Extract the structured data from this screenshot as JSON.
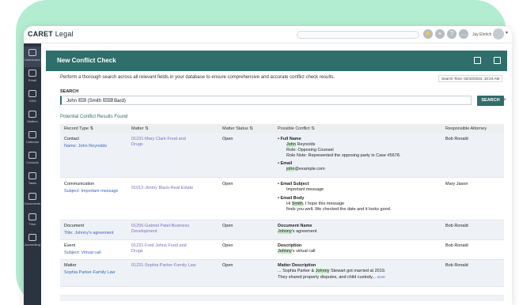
{
  "app": {
    "logo": "CARET",
    "logo_sub": "Legal",
    "user_name": "Jay Ehrlich"
  },
  "topbar_icons": [
    "bolt-icon",
    "plus-icon",
    "help-icon",
    "chat-icon",
    "star-icon"
  ],
  "sidebar": {
    "items": [
      {
        "label": "Dashboard",
        "icon": "dashboard-icon"
      },
      {
        "label": "Email",
        "icon": "email-icon"
      },
      {
        "label": "CRM",
        "icon": "crm-icon"
      },
      {
        "label": "Matters",
        "icon": "matters-icon"
      },
      {
        "label": "Calendar",
        "icon": "calendar-icon"
      },
      {
        "label": "Contacts",
        "icon": "contacts-icon"
      },
      {
        "label": "Tasks",
        "icon": "tasks-icon"
      },
      {
        "label": "Documents",
        "icon": "documents-icon"
      },
      {
        "label": "Time",
        "icon": "time-icon"
      },
      {
        "label": "Accounting",
        "icon": "accounting-icon"
      }
    ]
  },
  "page": {
    "title": "New Conflict Check",
    "description": "Perform a thorough search across all relevant fields in your database to ensure comprehensive and accurate conflict check results.",
    "search_time": "Search Time: 02/10/2024, 10:24 AM"
  },
  "search": {
    "label": "SEARCH",
    "term1": "John",
    "op1": "OR",
    "term2": "(Smith",
    "op2": "NOT",
    "term3": "Bard)",
    "button": "SEARCH"
  },
  "results": {
    "title": "Potential Conflict Results Found",
    "columns": [
      "Record Type",
      "Matter",
      "Matter Status",
      "Possible Conflict",
      "Responsible Attorney"
    ],
    "rows": [
      {
        "type": "Contact",
        "sub": "Name: John Reynolds",
        "matter": "01231-Mary Clark-Food and Drugs",
        "status": "Open",
        "attorney": "Bob Ronald",
        "c1_head": "Full Name",
        "c1_hl": "John",
        "c1_rest": " Reynolds",
        "c1_l2": "Role: Opposing Counsel",
        "c1_l3": "Role Note: Represented the opposing party in Case #5678.",
        "c2_head": "Email",
        "c2_hl": "john",
        "c2_rest": "@example.com"
      },
      {
        "type": "Communication",
        "sub": "Subject: Important message",
        "matter": "01012-Jimmy Black-Real Estate",
        "status": "Open",
        "attorney": "Mary Jason",
        "c1_head": "Email Subject",
        "c1_l1": "Important message",
        "c2_head": "Email Body",
        "c2_pre": "Hi ",
        "c2_hl": "Smith",
        "c2_rest": ", I hope this message",
        "c2_l2": "finds you well. We checked the date and it looks good."
      },
      {
        "type": "Document",
        "sub": "Title: Johnny's agreement",
        "matter": "01256-Gabriel Patel-Business Development",
        "status": "Open",
        "attorney": "Bob Ronald",
        "c_head": "Document Name",
        "c_hl": "Johnny",
        "c_rest": "'s agreement"
      },
      {
        "type": "Event",
        "sub": "Subject: Virtual call",
        "matter": "01231-Fred Johns-Food and Drugs",
        "status": "Open",
        "attorney": "Bob Ronald",
        "c_head": "Description",
        "c_hl": "Johnny",
        "c_rest": "'s virtual call"
      },
      {
        "type": "Matter",
        "sub": "Sophia Parker-Family Law",
        "matter": "01231-Sophia Parker-Family Law",
        "status": "Open",
        "attorney": "Bob Ronald",
        "c_head": "Matter Description",
        "c_pre": "... Sophia Parker & ",
        "c_hl": "Johnny",
        "c_rest": " Stewart got married at 2019.",
        "c_l2": "They shared property disputes, and child custody...",
        "c_more": "more"
      }
    ]
  }
}
